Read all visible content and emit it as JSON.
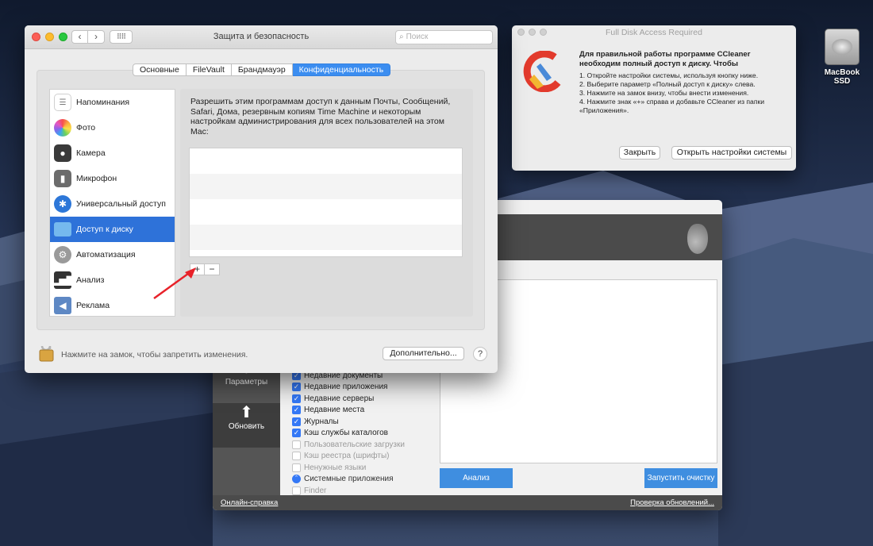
{
  "colors": {
    "accent": "#3b8df0",
    "selection": "#2e72d9",
    "ccleaner_dark": "#4b4b4b",
    "ccleaner_button": "#3f8ee0",
    "arrow": "#e8222a"
  },
  "desktop": {
    "drive_label": "MacBook SSD",
    "drive_icon": "hard-drive-icon"
  },
  "syspref": {
    "title": "Защита и безопасность",
    "search_placeholder": "Поиск",
    "tabs": [
      {
        "label": "Основные",
        "selected": false
      },
      {
        "label": "FileVault",
        "selected": false
      },
      {
        "label": "Брандмауэр",
        "selected": false
      },
      {
        "label": "Конфиденциальность",
        "selected": true
      }
    ],
    "sidebar": [
      {
        "label": "Напоминания",
        "icon": "reminders-icon"
      },
      {
        "label": "Фото",
        "icon": "photos-icon"
      },
      {
        "label": "Камера",
        "icon": "camera-icon"
      },
      {
        "label": "Микрофон",
        "icon": "microphone-icon"
      },
      {
        "label": "Универсальный доступ",
        "icon": "accessibility-icon"
      },
      {
        "label": "Доступ к диску",
        "icon": "folder-icon",
        "selected": true
      },
      {
        "label": "Автоматизация",
        "icon": "gear-icon"
      },
      {
        "label": "Анализ",
        "icon": "chart-icon"
      },
      {
        "label": "Реклама",
        "icon": "megaphone-icon"
      }
    ],
    "description": "Разрешить этим программам доступ к данным Почты, Сообщений, Safari, Дома, резервным копиям Time Machine и некоторым настройкам администрирования для всех пользователей на этом Mac:",
    "add_label": "+",
    "remove_label": "−",
    "lock_text": "Нажмите на замок, чтобы запретить изменения.",
    "advanced_label": "Дополнительно...",
    "help_label": "?"
  },
  "fda_dialog": {
    "title": "Full Disk Access Required",
    "heading": "Для правильной работы программе CCleaner необходим полный доступ к диску. Чтобы",
    "steps": [
      "1. Откройте настройки системы, используя кнопку ниже.",
      "2. Выберите параметр «Полный доступ к диску» слева.",
      "3. Нажмите на замок внизу, чтобы внести изменения.",
      "4. Нажмите знак «+» справа и добавьте CCleaner из папки «Приложения»."
    ],
    "close_label": "Закрыть",
    "open_settings_label": "Открыть настройки системы"
  },
  "ccleaner": {
    "nav": [
      {
        "label": "Параметры",
        "icon": "gear-icon"
      },
      {
        "label": "Обновить",
        "icon": "arrow-up-icon"
      }
    ],
    "items": [
      {
        "label": "Недавние документы",
        "checked": true
      },
      {
        "label": "Недавние приложения",
        "checked": true
      },
      {
        "label": "Недавние серверы",
        "checked": true
      },
      {
        "label": "Недавние места",
        "checked": true
      },
      {
        "label": "Журналы",
        "checked": true
      },
      {
        "label": "Кэш службы каталогов",
        "checked": true
      },
      {
        "label": "Пользовательские загрузки",
        "checked": false
      },
      {
        "label": "Кэш реестра (шрифты)",
        "checked": false
      },
      {
        "label": "Ненужные языки",
        "checked": false
      },
      {
        "label": "Системные приложения",
        "section": true
      },
      {
        "label": "Finder",
        "checked": false
      }
    ],
    "analyze_label": "Анализ",
    "run_label": "Запустить очистку",
    "help_link": "Онлайн-справка",
    "update_link": "Проверка обновлений..."
  }
}
